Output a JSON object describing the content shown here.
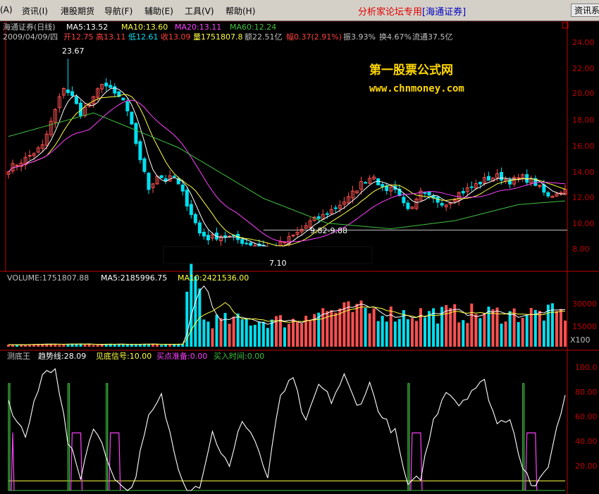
{
  "colors": {
    "up": "#ff5050",
    "down": "#00e0f0",
    "ma5": "#ffffff",
    "ma10": "#ffff40",
    "ma20": "#ff40ff",
    "ma60": "#40c040",
    "axis": "#c00000",
    "text": "#ffffff"
  },
  "menu": {
    "items": [
      "(A)",
      "资讯(I)",
      "港股期货",
      "导航(F)",
      "辅助(E)",
      "工具(V)",
      "帮助(H)"
    ],
    "brand_text": "分析家论坛专用",
    "brand_broker": "[海通证券]",
    "right_button": "资讯系"
  },
  "price_panel": {
    "title": "海通证券(日线)",
    "ma5": "MA5:13.52",
    "ma10": "MA10:13.60",
    "ma20": "MA20:13.11",
    "ma60": "MA60:12.24",
    "info": {
      "date": "2009/04/09/四",
      "open": "开12.75",
      "high": "高13.11",
      "low": "低12.61",
      "close": "收13.09",
      "vol": "量1751807.8",
      "amount": "额22.51亿",
      "change": "幅0.37(2.91%)",
      "amplitude": "振3.93%",
      "turnover": "换4.67%",
      "float": "流通37.5亿"
    },
    "max_label": "23.67",
    "min_label": "7.10",
    "range_label": "9.82-9.88",
    "watermark_cn": "第一股票公式网",
    "watermark_url": "www.chnmoney.com",
    "y_ticks": [
      "24.00",
      "22.00",
      "20.00",
      "18.00",
      "16.00",
      "14.00",
      "12.00",
      "10.00",
      "8.00"
    ]
  },
  "volume_panel": {
    "label": "VOLUME:1751807.88",
    "ma5": "MA5:2185996.75",
    "ma10": "MA10:2421536.00",
    "y_ticks": [
      "30000",
      "15000"
    ],
    "unit": "X100"
  },
  "indicator_panel": {
    "name": "测底王",
    "trend": "趋势线:28.09",
    "signal": "见底信号:10.00",
    "buy_prep": "买点准备:0.00",
    "buy_time": "买入时间:0.00",
    "y_ticks": [
      "100.0",
      "80.00",
      "60.00",
      "40.00",
      "20.00"
    ]
  },
  "chart_data": [
    {
      "type": "candlestick",
      "y_range": [
        6.8,
        25
      ],
      "reference_line": 9.85,
      "max": 23.67,
      "min": 7.1
    },
    {
      "type": "bar",
      "name": "volume",
      "unit": "X100"
    },
    {
      "type": "line",
      "y_range": [
        0,
        108
      ]
    }
  ]
}
